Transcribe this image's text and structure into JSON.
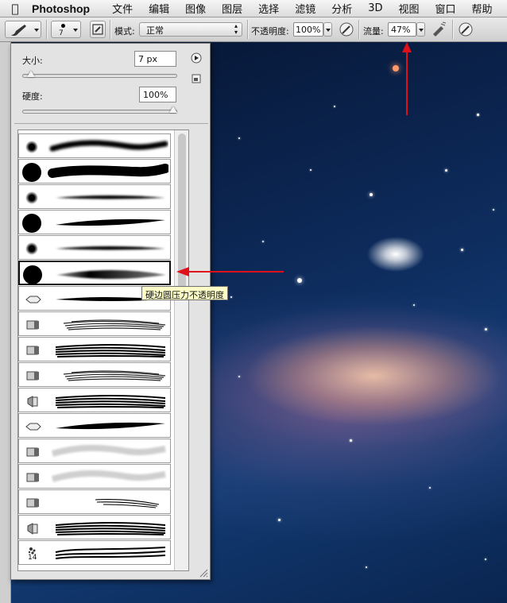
{
  "menubar": {
    "apple_icon": "apple-logo-icon",
    "app_name": "Photoshop",
    "menus": [
      "文件",
      "编辑",
      "图像",
      "图层",
      "选择",
      "滤镜",
      "分析",
      "3D",
      "视图",
      "窗口",
      "帮助"
    ]
  },
  "options_bar": {
    "brush_size_value": "7",
    "mode_label": "模式:",
    "mode_value": "正常",
    "opacity_label": "不透明度:",
    "opacity_value": "100%",
    "flow_label": "流量:",
    "flow_value": "47%"
  },
  "brush_panel": {
    "size_label": "大小:",
    "size_value": "7 px",
    "size_slider_fraction": 0.03,
    "hardness_label": "硬度:",
    "hardness_value": "100%",
    "hardness_slider_fraction": 1.0,
    "presets": [
      {
        "kind": "soft",
        "stroke": "soft"
      },
      {
        "kind": "hard",
        "stroke": "hard"
      },
      {
        "kind": "soft",
        "stroke": "taper-soft"
      },
      {
        "kind": "hard",
        "stroke": "taper-hard"
      },
      {
        "kind": "soft",
        "stroke": "taper-soft"
      },
      {
        "kind": "hard",
        "stroke": "taper-fade",
        "selected": true
      },
      {
        "kind": "tip",
        "stroke": "taper-thin"
      },
      {
        "kind": "bristle",
        "stroke": "bristle"
      },
      {
        "kind": "bristle",
        "stroke": "bristle-dark"
      },
      {
        "kind": "bristle",
        "stroke": "bristle"
      },
      {
        "kind": "fan",
        "stroke": "bristle-dark"
      },
      {
        "kind": "tip",
        "stroke": "taper-hard"
      },
      {
        "kind": "bristle",
        "stroke": "light"
      },
      {
        "kind": "bristle",
        "stroke": "light"
      },
      {
        "kind": "bristle",
        "stroke": "scratch"
      },
      {
        "kind": "fan",
        "stroke": "bristle-dark"
      },
      {
        "kind": "splatter",
        "label": "14",
        "stroke": "wavy"
      }
    ],
    "tooltip": "硬边圆压力不透明度"
  },
  "colors": {
    "arrow": "#e0101a",
    "tooltip_bg": "#ffffc8"
  }
}
